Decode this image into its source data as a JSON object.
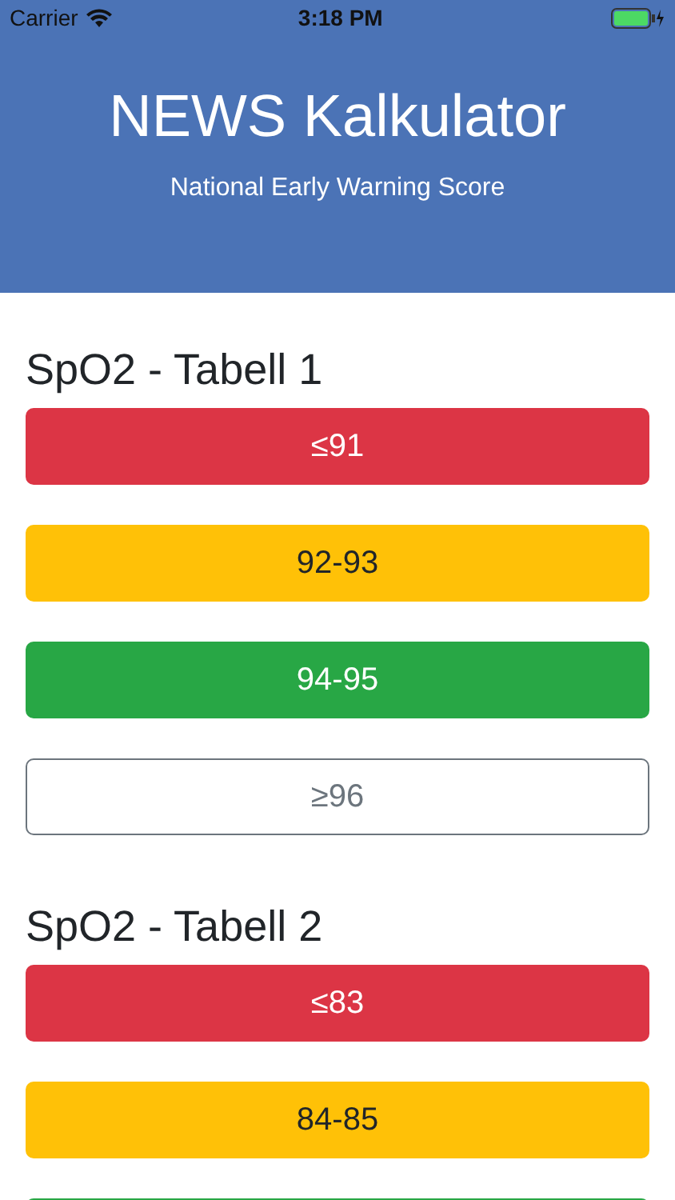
{
  "status_bar": {
    "carrier": "Carrier",
    "time": "3:18 PM"
  },
  "header": {
    "title": "NEWS Kalkulator",
    "subtitle": "National Early Warning Score"
  },
  "sections": [
    {
      "title": "SpO2 - Tabell 1",
      "buttons": [
        {
          "label": "≤91",
          "kind": "danger"
        },
        {
          "label": "92-93",
          "kind": "warning"
        },
        {
          "label": "94-95",
          "kind": "success"
        },
        {
          "label": "≥96",
          "kind": "outline"
        }
      ]
    },
    {
      "title": "SpO2 - Tabell 2",
      "buttons": [
        {
          "label": "≤83",
          "kind": "danger"
        },
        {
          "label": "84-85",
          "kind": "warning"
        },
        {
          "kind": "success"
        }
      ]
    }
  ]
}
